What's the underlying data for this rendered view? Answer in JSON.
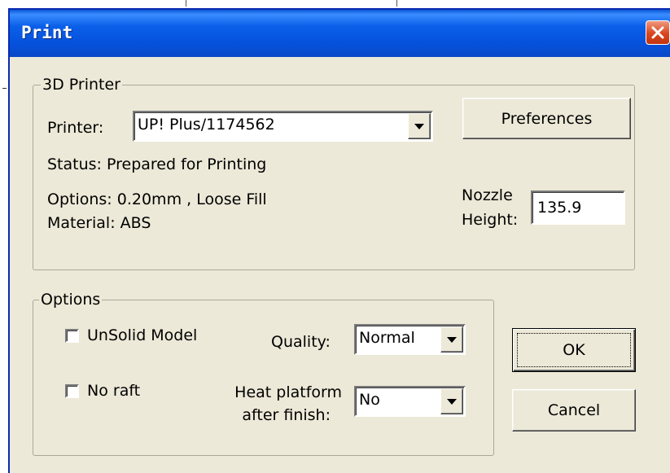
{
  "window": {
    "title": "Print"
  },
  "printer_group": {
    "label": "3D Printer",
    "printer_label": "Printer:",
    "printer_value": "UP! Plus/1174562",
    "preferences_button": "Preferences",
    "status_text": "Status: Prepared for Printing",
    "options_text": "Options: 0.20mm , Loose Fill",
    "material_text": "Material: ABS",
    "nozzle_label_line1": "Nozzle",
    "nozzle_label_line2": "Height:",
    "nozzle_value": "135.9"
  },
  "options_group": {
    "label": "Options",
    "unsolid_label": "UnSolid Model",
    "unsolid_checked": false,
    "noraft_label": "No raft",
    "noraft_checked": false,
    "quality_label": "Quality:",
    "quality_value": "Normal",
    "heat_label_line1": "Heat platform",
    "heat_label_line2": "after finish:",
    "heat_value": "No"
  },
  "buttons": {
    "ok": "OK",
    "cancel": "Cancel"
  },
  "icons": {
    "close": "close-icon",
    "dropdown": "chevron-down-icon"
  },
  "colors": {
    "titlebar": "#0a5fe8",
    "dialog_bg": "#ece9d8",
    "close_button": "#d9451e"
  }
}
